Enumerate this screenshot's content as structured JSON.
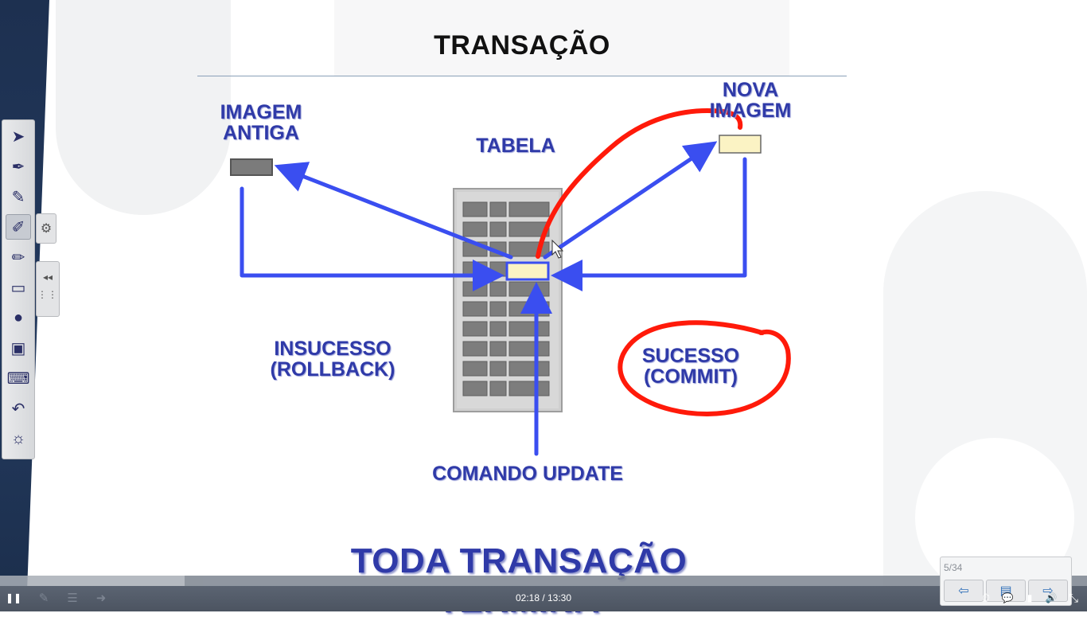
{
  "slide": {
    "title": "TRANSAÇÃO",
    "labels": {
      "old_image": "IMAGEM ANTIGA",
      "new_image": "NOVA IMAGEM",
      "table": "TABELA",
      "failure": "INSUCESSO (ROLLBACK)",
      "success": "SUCESSO (COMMIT)",
      "update_command": "COMANDO UPDATE"
    },
    "bottom_text": "TODA TRANSAÇÃO TERMINA"
  },
  "ink_toolbar": {
    "tools": [
      {
        "name": "pointer-icon",
        "glyph": "➤"
      },
      {
        "name": "pen-icon",
        "glyph": "✒"
      },
      {
        "name": "marker-icon",
        "glyph": "✎"
      },
      {
        "name": "colored-pen-icon",
        "glyph": "✐"
      },
      {
        "name": "highlighter-icon",
        "glyph": "✏"
      },
      {
        "name": "eraser-icon",
        "glyph": "▭"
      },
      {
        "name": "laser-pointer-icon",
        "glyph": "●"
      },
      {
        "name": "whiteboard-icon",
        "glyph": "▣"
      },
      {
        "name": "keyboard-icon",
        "glyph": "⌨"
      },
      {
        "name": "undo-icon",
        "glyph": "↶"
      },
      {
        "name": "spotlight-icon",
        "glyph": "☼"
      }
    ],
    "active_index": 3,
    "gear_glyph": "⚙",
    "collapse_glyph": "◂◂"
  },
  "player": {
    "time": "02:18 / 13:30",
    "progress": 0.17,
    "page_indicator": "5/34",
    "icons": {
      "pause": "❚❚",
      "pen": "✎",
      "menu": "☰",
      "forward": "➜",
      "prev": "⇦",
      "notes": "▤",
      "next": "⇨",
      "timer": "⏱",
      "chat": "💬",
      "signal": "▮",
      "volume": "🔊",
      "fullscreen": "⤡"
    }
  },
  "colors": {
    "label_blue": "#2f3aa8",
    "arrow_blue": "#3a4ef0",
    "ink_red": "#ff1a0a",
    "box_fill": "#fbf3c4"
  }
}
